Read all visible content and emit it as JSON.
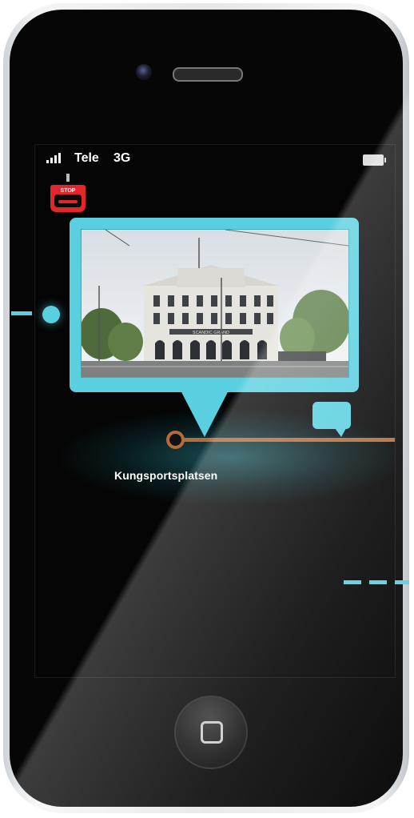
{
  "status_bar": {
    "carrier": "Tele",
    "network": "3G"
  },
  "stop_badge": {
    "text": "STOP"
  },
  "current_stop": {
    "name": "Kungsportsplatsen"
  },
  "photo_sign": "SCANDIC GRAND",
  "icons": {
    "signal": "signal-bars-icon",
    "battery": "battery-icon",
    "stop": "stop-button-icon",
    "chat": "speech-bubble-icon",
    "home": "home-button-icon"
  },
  "colors": {
    "accent": "#59cfe0",
    "route": "#b56a3a",
    "stop_red": "#e3262b"
  }
}
